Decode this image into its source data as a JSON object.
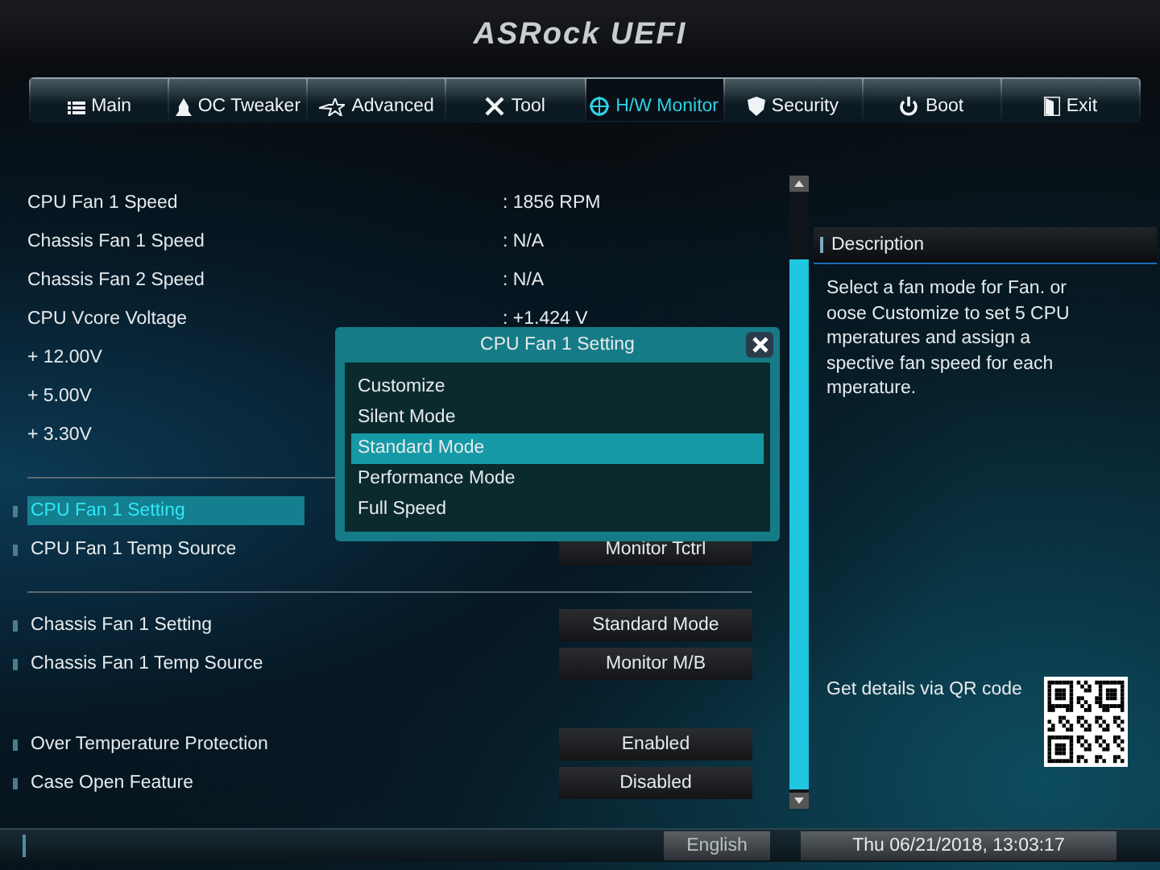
{
  "header": {
    "logo": "ASRock UEFI"
  },
  "tabs": [
    {
      "label": "Main",
      "selected": false
    },
    {
      "label": "OC Tweaker",
      "selected": false
    },
    {
      "label": "Advanced",
      "selected": false
    },
    {
      "label": "Tool",
      "selected": false
    },
    {
      "label": "H/W Monitor",
      "selected": true
    },
    {
      "label": "Security",
      "selected": false
    },
    {
      "label": "Boot",
      "selected": false
    },
    {
      "label": "Exit",
      "selected": false
    }
  ],
  "rows": [
    {
      "kind": "reading",
      "label": "CPU Fan 1 Speed",
      "value": ": 1856 RPM"
    },
    {
      "kind": "reading",
      "label": "Chassis Fan 1 Speed",
      "value": ": N/A"
    },
    {
      "kind": "reading",
      "label": "Chassis Fan 2 Speed",
      "value": ": N/A"
    },
    {
      "kind": "reading",
      "label": "CPU Vcore Voltage",
      "value": ": +1.424 V"
    },
    {
      "kind": "reading",
      "label": "+ 12.00V"
    },
    {
      "kind": "reading",
      "label": "+ 5.00V"
    },
    {
      "kind": "reading",
      "label": "+ 3.30V"
    },
    {
      "kind": "divider"
    },
    {
      "kind": "setting",
      "label": "CPU Fan 1 Setting",
      "selected": true
    },
    {
      "kind": "setting",
      "label": "CPU Fan 1 Temp Source",
      "value": "Monitor Tctrl",
      "selected": false
    },
    {
      "kind": "divider"
    },
    {
      "kind": "setting",
      "label": "Chassis Fan 1 Setting",
      "value": "Standard Mode",
      "selected": false
    },
    {
      "kind": "setting",
      "label": "Chassis Fan 1 Temp Source",
      "value": "Monitor M/B",
      "selected": false
    },
    {
      "kind": "gap"
    },
    {
      "kind": "setting",
      "label": "Over Temperature Protection",
      "value": "Enabled",
      "selected": false
    },
    {
      "kind": "setting",
      "label": "Case Open Feature",
      "value": "Disabled",
      "selected": false
    }
  ],
  "popup": {
    "title": "CPU Fan 1 Setting",
    "options": [
      {
        "label": "Customize",
        "selected": false
      },
      {
        "label": "Silent Mode",
        "selected": false
      },
      {
        "label": "Standard Mode",
        "selected": true
      },
      {
        "label": "Performance Mode",
        "selected": false
      },
      {
        "label": "Full Speed",
        "selected": false
      }
    ]
  },
  "description": {
    "title": "Description",
    "lines": [
      "Select a fan mode for Fan. or",
      "oose Customize to set 5 CPU",
      "mperatures and assign a",
      "spective fan speed for each",
      "mperature."
    ],
    "qr_text": "Get details via QR code"
  },
  "status_bar": {
    "language": "English",
    "datetime": "Thu 06/21/2018, 13:03:17"
  }
}
